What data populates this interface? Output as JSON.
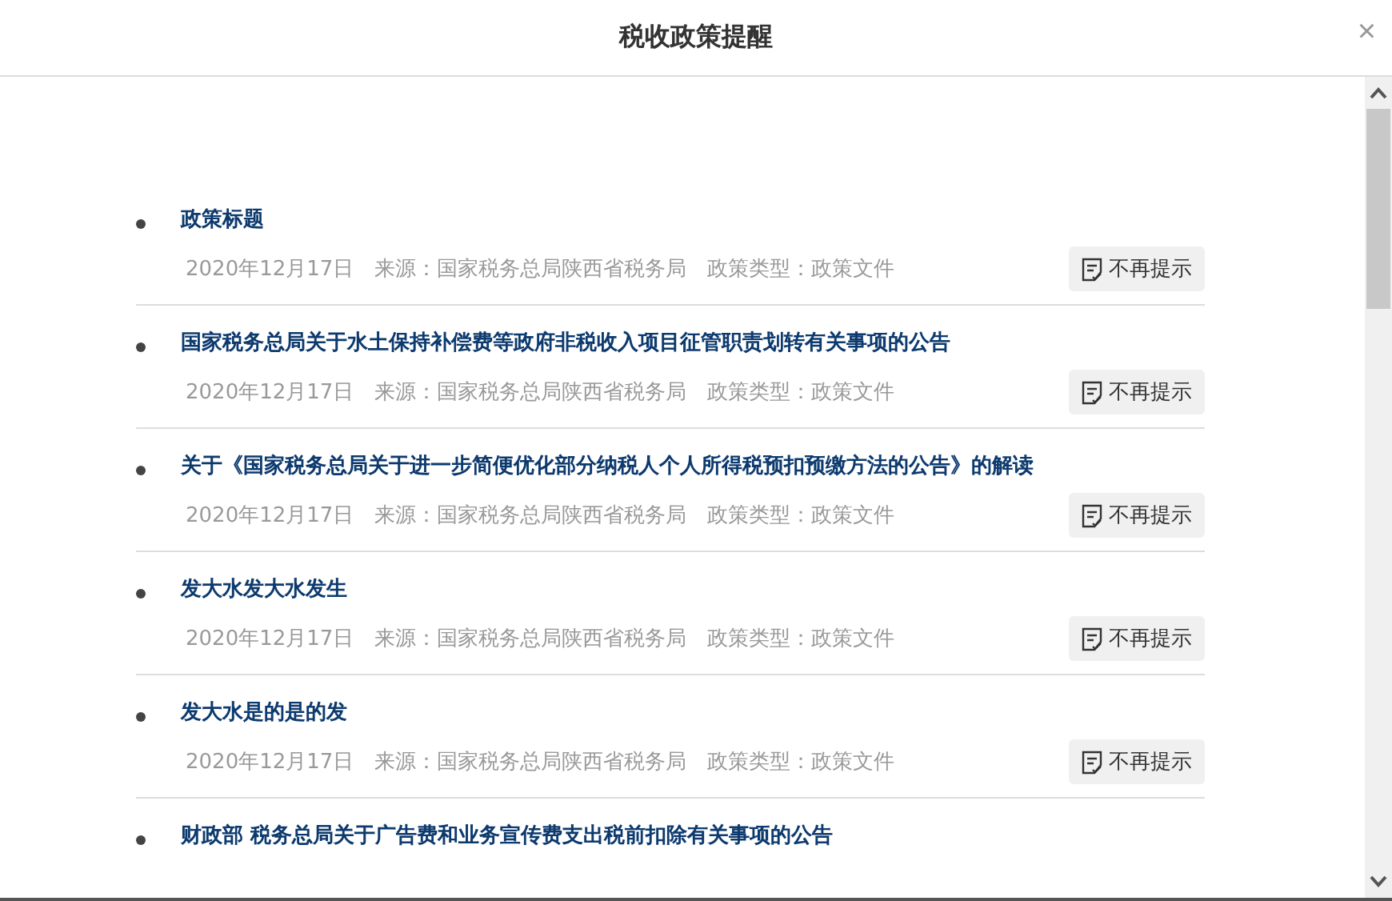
{
  "dialog": {
    "title": "税收政策提醒",
    "close": "×"
  },
  "policies": [
    {
      "title": "政策标题",
      "date": "2020年12月17日",
      "source": "来源：国家税务总局陕西省税务局",
      "type": "政策类型：政策文件",
      "action": "不再提示"
    },
    {
      "title": "国家税务总局关于水土保持补偿费等政府非税收入项目征管职责划转有关事项的公告",
      "date": "2020年12月17日",
      "source": "来源：国家税务总局陕西省税务局",
      "type": "政策类型：政策文件",
      "action": "不再提示"
    },
    {
      "title": "关于《国家税务总局关于进一步简便优化部分纳税人个人所得税预扣预缴方法的公告》的解读",
      "date": "2020年12月17日",
      "source": "来源：国家税务总局陕西省税务局",
      "type": "政策类型：政策文件",
      "action": "不再提示"
    },
    {
      "title": "发大水发大水发生",
      "date": "2020年12月17日",
      "source": "来源：国家税务总局陕西省税务局",
      "type": "政策类型：政策文件",
      "action": "不再提示"
    },
    {
      "title": "发大水是的是的发",
      "date": "2020年12月17日",
      "source": "来源：国家税务总局陕西省税务局",
      "type": "政策类型：政策文件",
      "action": "不再提示"
    },
    {
      "title": "财政部 税务总局关于广告费和业务宣传费支出税前扣除有关事项的公告"
    }
  ]
}
